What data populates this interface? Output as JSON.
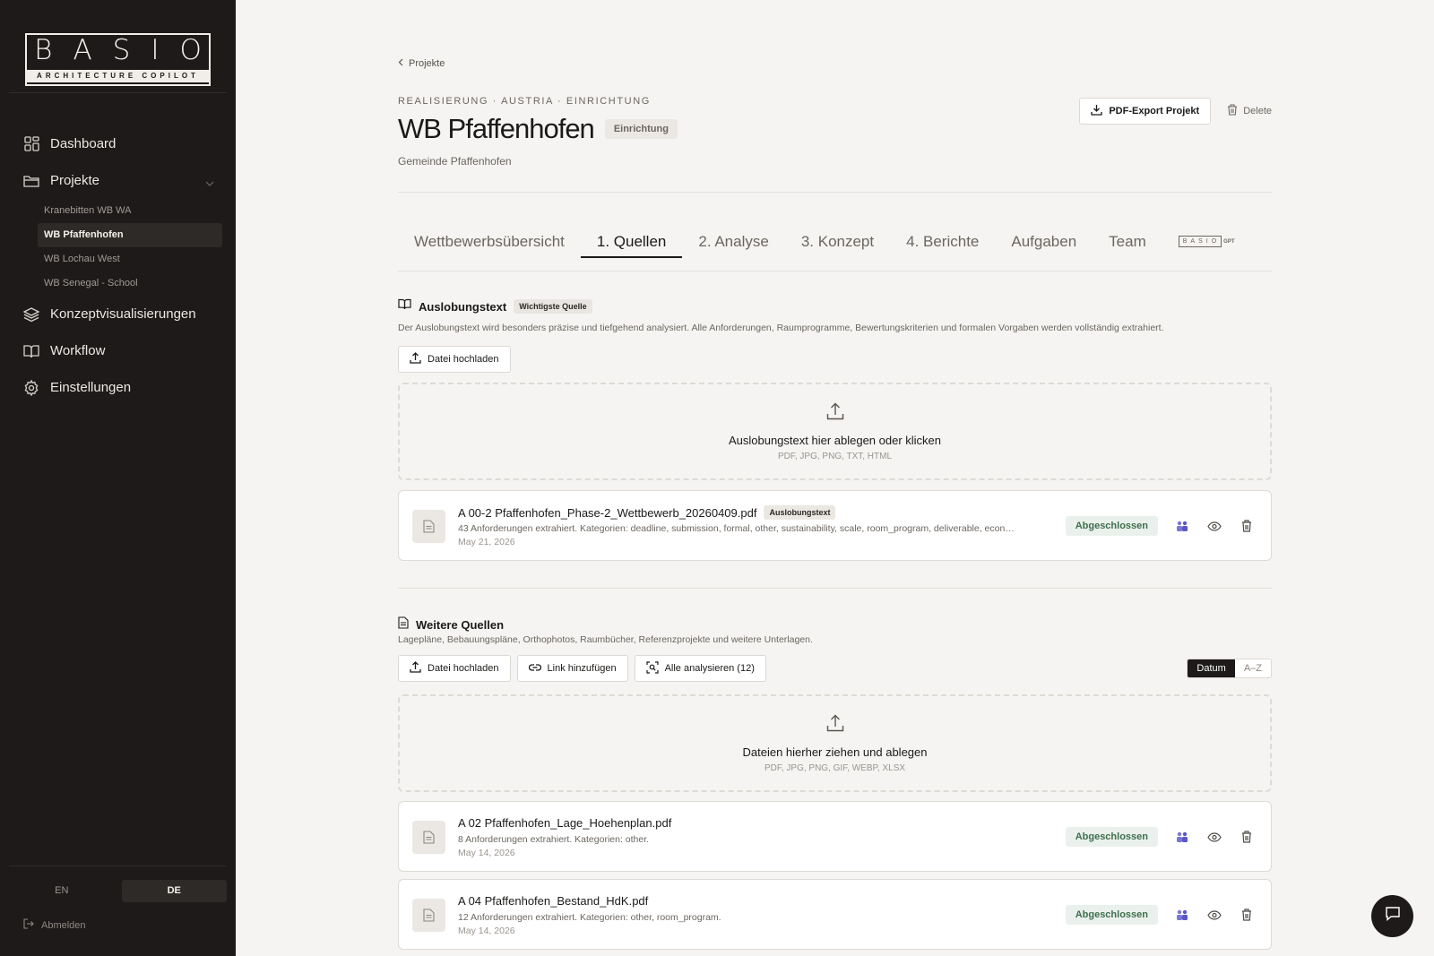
{
  "sidebar": {
    "logo": {
      "word": "BASIO",
      "tagline": "ARCHITECTURE COPILOT"
    },
    "nav": {
      "dashboard": "Dashboard",
      "projekte": "Projekte",
      "konzept": "Konzeptvisualisierungen",
      "workflow": "Workflow",
      "einstellungen": "Einstellungen"
    },
    "projects": [
      "Kranebitten WB WA",
      "WB Pfaffenhofen",
      "WB Lochau West",
      "WB Senegal - School"
    ],
    "active_project": "WB Pfaffenhofen",
    "lang": {
      "en": "EN",
      "de": "DE",
      "active": "DE"
    },
    "logout": "Abmelden"
  },
  "header": {
    "breadcrumb": "Projekte",
    "meta": "REALISIERUNG · AUSTRIA · EINRICHTUNG",
    "title": "WB Pfaffenhofen",
    "phase_badge": "Einrichtung",
    "subtitle": "Gemeinde Pfaffenhofen",
    "export_label": "PDF-Export Projekt",
    "delete_label": "Delete"
  },
  "tabs": {
    "items": [
      "Wettbewerbsübersicht",
      "1. Quellen",
      "2. Analyse",
      "3. Konzept",
      "4. Berichte",
      "Aufgaben",
      "Team"
    ],
    "active": "1. Quellen",
    "gpt_logo": "BASIO",
    "gpt_suffix": "GPT"
  },
  "auslobung": {
    "title": "Auslobungstext",
    "tag": "Wichtigste Quelle",
    "description": "Der Auslobungstext wird besonders präzise und tiefgehend analysiert. Alle Anforderungen, Raumprogramme, Bewertungskriterien und formalen Vorgaben werden vollständig extrahiert.",
    "upload_label": "Datei hochladen",
    "dropzone_title": "Auslobungstext hier ablegen oder klicken",
    "dropzone_formats": "PDF, JPG, PNG, TXT, HTML",
    "file": {
      "name": "A 00-2 Pfaffenhofen_Phase-2_Wettbewerb_20260409.pdf",
      "tag": "Auslobungstext",
      "description": "43 Anforderungen extrahiert. Kategorien: deadline, submission, formal, other, sustainability, scale, room_program, deliverable, econ…",
      "date": "May 21, 2026",
      "status": "Abgeschlossen"
    }
  },
  "weitere": {
    "title": "Weitere Quellen",
    "description": "Lagepläne, Bebauungspläne, Orthophotos, Raumbücher, Referenzprojekte und weitere Unterlagen.",
    "upload_label": "Datei hochladen",
    "link_label": "Link hinzufügen",
    "analyze_label": "Alle analysieren (12)",
    "sort": {
      "date": "Datum",
      "az": "A–Z",
      "active": "Datum"
    },
    "dropzone_title": "Dateien hierher ziehen und ablegen",
    "dropzone_formats": "PDF, JPG, PNG, GIF, WEBP, XLSX",
    "files": [
      {
        "name": "A 02 Pfaffenhofen_Lage_Hoehenplan.pdf",
        "description": "8 Anforderungen extrahiert. Kategorien: other.",
        "date": "May 14, 2026",
        "status": "Abgeschlossen"
      },
      {
        "name": "A 04 Pfaffenhofen_Bestand_HdK.pdf",
        "description": "12 Anforderungen extrahiert. Kategorien: other, room_program.",
        "date": "May 14, 2026",
        "status": "Abgeschlossen"
      }
    ]
  },
  "colors": {
    "sidebar_bg": "#1d1a19",
    "page_bg": "#f5f4f2",
    "status_green": "#3e6f4d",
    "team_icon": "#5a56c8"
  }
}
